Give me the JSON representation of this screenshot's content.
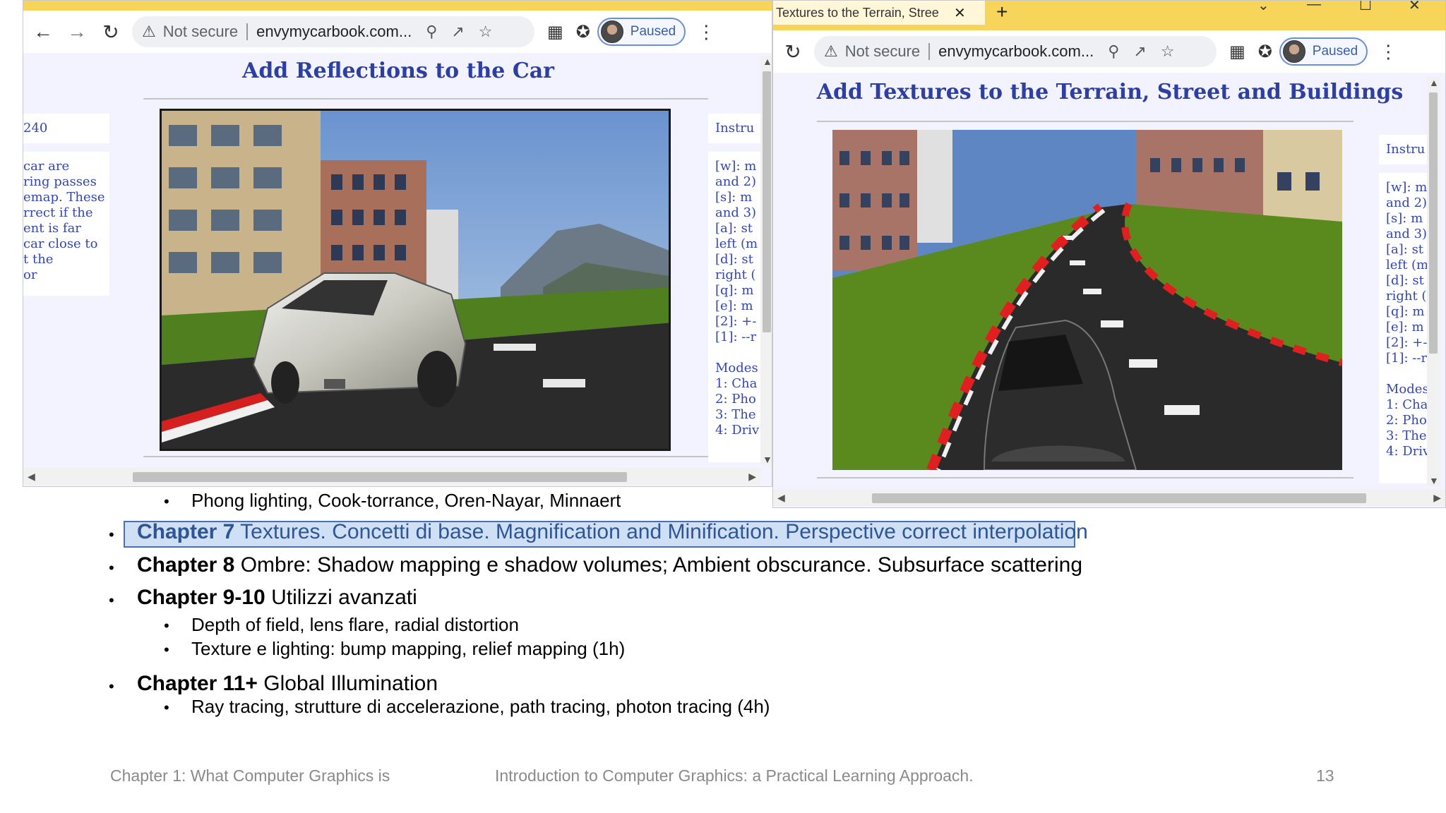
{
  "browser_left": {
    "nav": {
      "back_icon": "back-arrow-icon",
      "forward_icon": "forward-arrow-icon",
      "reload_icon": "reload-icon"
    },
    "omnibox": {
      "security": "Not secure",
      "url": "envymycarbook.com..."
    },
    "profile": {
      "status": "Paused"
    },
    "page": {
      "title": "Add Reflections to the Car",
      "left_panel_top": "240",
      "left_panel_text": [
        "car are",
        "ring passes",
        "emap. These",
        "rrect if the",
        "ent is far",
        "car close to",
        "t the",
        "or"
      ],
      "right_panel_title": "Instru",
      "right_panel_lines": [
        "[w]: m",
        "and 2)",
        "[s]: m",
        "and 3)",
        "[a]: st",
        "left (m",
        "[d]: st",
        "right (",
        "[q]: m",
        "[e]: m",
        "[2]: +-",
        "[1]: --r",
        "",
        "Modes",
        "1: Cha",
        "2: Pho",
        "3: The",
        "4: Driv"
      ]
    }
  },
  "browser_right": {
    "tab": {
      "title": "Textures to the Terrain, Stree"
    },
    "nav": {
      "reload_icon": "reload-icon"
    },
    "omnibox": {
      "security": "Not secure",
      "url": "envymycarbook.com..."
    },
    "profile": {
      "status": "Paused"
    },
    "page": {
      "title": "Add Textures to the Terrain, Street and Buildings",
      "right_panel_title": "Instru",
      "right_panel_lines": [
        "[w]: m",
        "and 2)",
        "[s]: m",
        "and 3)",
        "[a]: st",
        "left (m",
        "[d]: st",
        "right (",
        "[q]: m",
        "[e]: m",
        "[2]: +-",
        "[1]: --r",
        "",
        "Modes",
        "1: Cha",
        "2: Pho",
        "3: The",
        "4: Driv"
      ]
    }
  },
  "slide": {
    "items": [
      {
        "level": 2,
        "chapter": "",
        "text": "Phong lighting, Cook-torrance, Oren-Nayar, Minnaert"
      },
      {
        "level": 1,
        "chapter": "Chapter 7",
        "text": " Textures. Concetti di base. Magnification and Minification. Perspective correct interpolation",
        "highlighted": true
      },
      {
        "level": 1,
        "chapter": "Chapter 8",
        "text": " Ombre: Shadow mapping e shadow volumes; Ambient obscurance.  Subsurface scattering"
      },
      {
        "level": 1,
        "chapter": "Chapter 9-10",
        "text": " Utilizzi avanzati"
      },
      {
        "level": 2,
        "chapter": "",
        "text": "Depth of field, lens flare, radial distortion"
      },
      {
        "level": 2,
        "chapter": "",
        "text": "Texture e lighting: bump mapping, relief mapping (1h)"
      },
      {
        "level": 1,
        "chapter": "Chapter 11+",
        "text": " Global Illumination"
      },
      {
        "level": 2,
        "chapter": "",
        "text": "Ray tracing, strutture di accelerazione, path tracing, photon tracing (4h)"
      }
    ],
    "bullet_glyph": "•",
    "footer": {
      "left": "Chapter 1: What Computer Graphics is",
      "center": "Introduction to Computer Graphics: a Practical Learning Approach.",
      "page": "13"
    },
    "colors": {
      "highlight_fill": "#cfe0f5",
      "highlight_border": "#4a6fb5",
      "highlight_text": "#2f5597",
      "page_heading": "#2d3fa0"
    }
  }
}
